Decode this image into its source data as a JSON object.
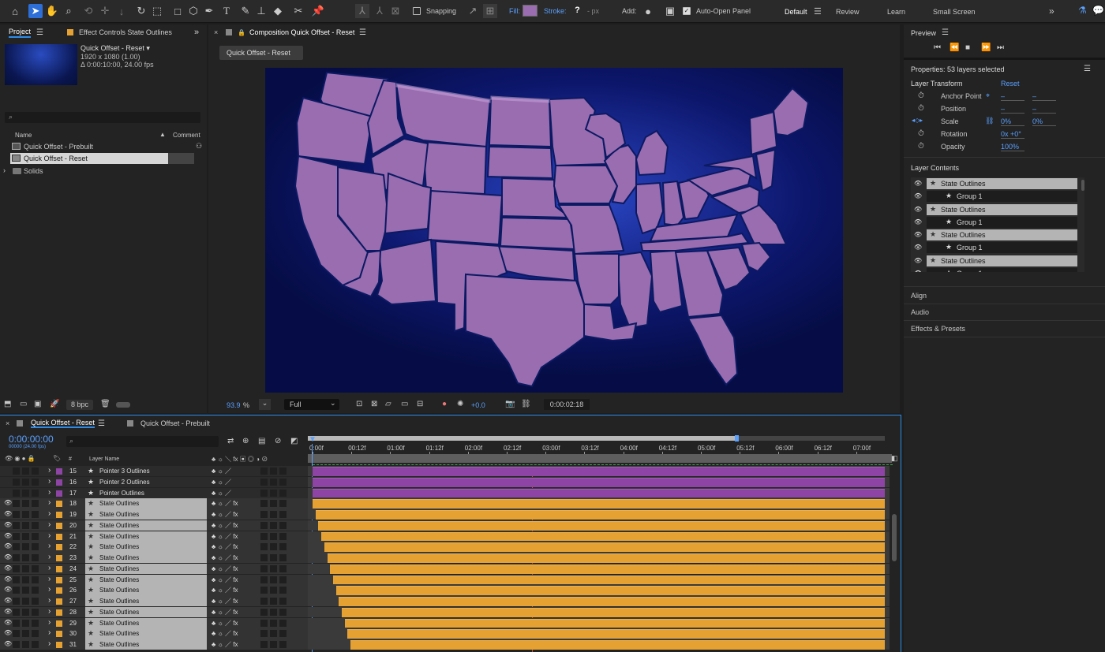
{
  "toolbar": {
    "snapping": "Snapping",
    "fill": "Fill:",
    "stroke": "Stroke:",
    "stroke_val": "?",
    "px": "- px",
    "add": "Add:",
    "auto_open": "Auto-Open Panel",
    "workspaces": [
      "Default",
      "Review",
      "Learn",
      "Small Screen"
    ]
  },
  "project": {
    "tab": "Project",
    "effect_tab": "Effect Controls State Outlines",
    "comp_name": "Quick Offset - Reset ▾",
    "res": "1920 x 1080 (1.00)",
    "dur": "Δ 0:00:10:00, 24.00 fps",
    "col_name": "Name",
    "col_comment": "Comment",
    "items": [
      "Quick Offset - Prebuilt",
      "Quick Offset - Reset",
      "Solids"
    ],
    "bpc": "8 bpc"
  },
  "comp": {
    "tab": "Composition Quick Offset - Reset",
    "chip": "Quick Offset - Reset",
    "zoom": "93.9",
    "zoom_unit": "%",
    "res": "Full",
    "exposure": "+0.0",
    "time": "0:00:02:18"
  },
  "preview": {
    "title": "Preview"
  },
  "properties": {
    "title": "Properties: 53 layers selected",
    "transform": "Layer Transform",
    "reset": "Reset",
    "rows": [
      {
        "label": "Anchor Point",
        "v1": "–",
        "v2": "–"
      },
      {
        "label": "Position",
        "v1": "–",
        "v2": "–"
      },
      {
        "label": "Scale",
        "v1": "0%",
        "v2": "0%"
      },
      {
        "label": "Rotation",
        "v1": "0x +0°",
        "v2": ""
      },
      {
        "label": "Opacity",
        "v1": "100%",
        "v2": ""
      }
    ],
    "contents": "Layer Contents",
    "items": [
      "State Outlines",
      "Group 1",
      "State Outlines",
      "Group 1",
      "State Outlines",
      "Group 1",
      "State Outlines",
      "Group 1"
    ],
    "sections": [
      "Align",
      "Audio",
      "Effects & Presets"
    ]
  },
  "timeline": {
    "tabs": [
      "Quick Offset - Reset",
      "Quick Offset - Prebuilt"
    ],
    "timecode": "0:00:00:00",
    "fps": "00000 (24.00 fps)",
    "col_layer": "Layer Name",
    "col_num": "#",
    "ruler": [
      "0:00f",
      "00:12f",
      "01:00f",
      "01:12f",
      "02:00f",
      "02:12f",
      "03:00f",
      "03:12f",
      "04:00f",
      "04:12f",
      "05:00f",
      "05:12f",
      "06:00f",
      "06:12f",
      "07:00f"
    ],
    "layers": [
      {
        "n": "15",
        "name": "Pointer 3 Outlines"
      },
      {
        "n": "16",
        "name": "Pointer 2 Outlines"
      },
      {
        "n": "17",
        "name": "Pointer Outlines"
      },
      {
        "n": "18",
        "name": "State Outlines"
      },
      {
        "n": "19",
        "name": "State Outlines"
      },
      {
        "n": "20",
        "name": "State Outlines"
      },
      {
        "n": "21",
        "name": "State Outlines"
      },
      {
        "n": "22",
        "name": "State Outlines"
      },
      {
        "n": "23",
        "name": "State Outlines"
      },
      {
        "n": "24",
        "name": "State Outlines"
      },
      {
        "n": "25",
        "name": "State Outlines"
      },
      {
        "n": "26",
        "name": "State Outlines"
      },
      {
        "n": "27",
        "name": "State Outlines"
      },
      {
        "n": "28",
        "name": "State Outlines"
      },
      {
        "n": "29",
        "name": "State Outlines"
      },
      {
        "n": "30",
        "name": "State Outlines"
      },
      {
        "n": "31",
        "name": "State Outlines"
      }
    ]
  },
  "colors": {
    "accent": "#2d8ceb",
    "purple": "#8e44a4",
    "orange": "#e5a233",
    "map": "#9a6cb0"
  }
}
